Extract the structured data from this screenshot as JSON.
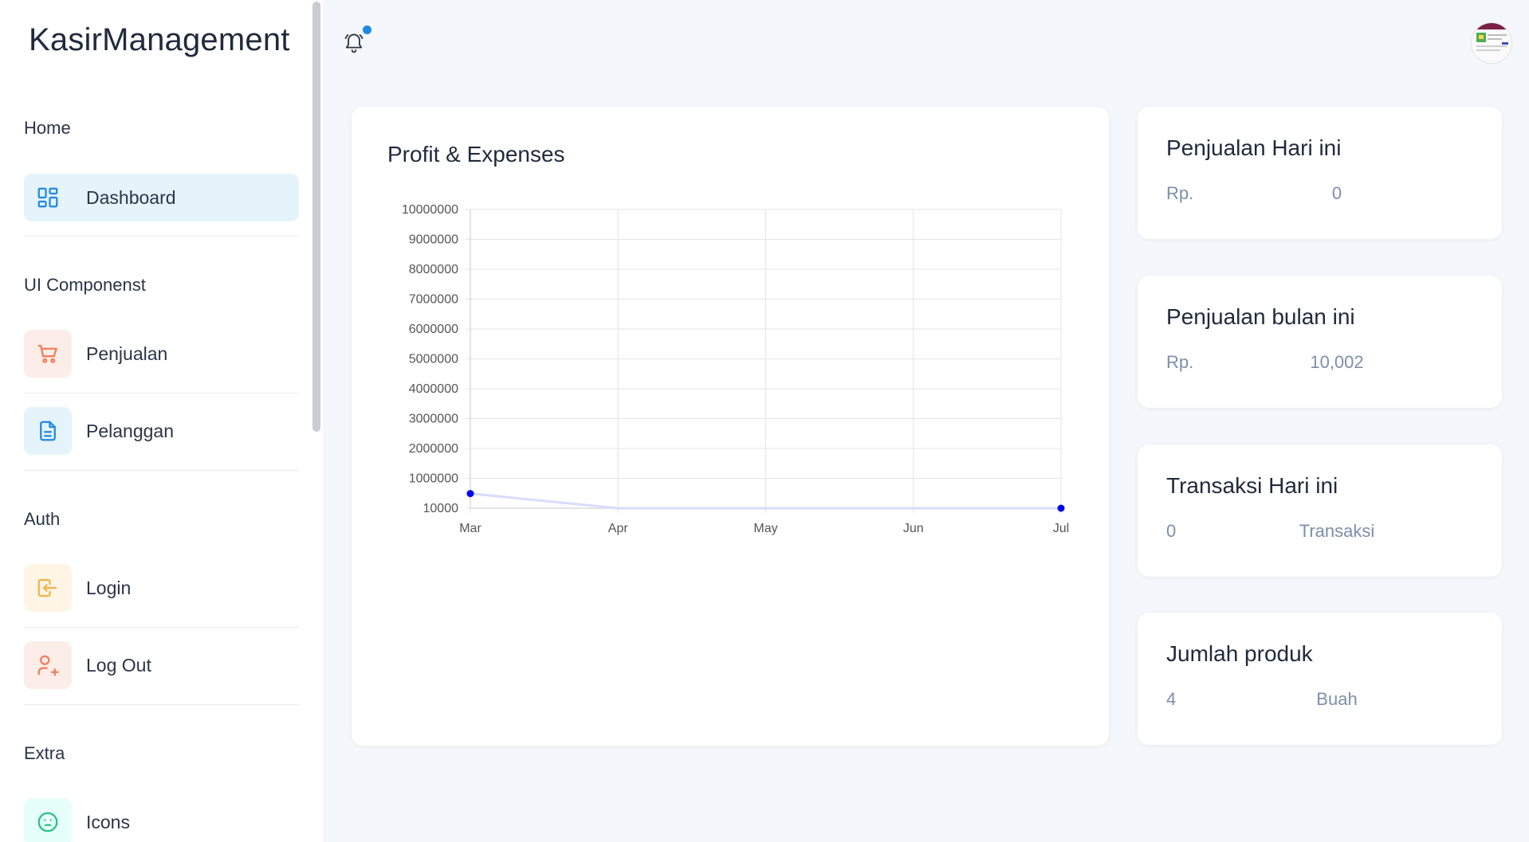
{
  "app": {
    "brand": "KasirManagement"
  },
  "sidebar": {
    "sections": [
      {
        "title": "Home",
        "items": [
          {
            "label": "Dashboard",
            "icon": "dashboard-icon",
            "active": true,
            "color": "#1e88e5"
          }
        ]
      },
      {
        "title": "UI Componenst",
        "items": [
          {
            "label": "Penjualan",
            "icon": "cart-icon",
            "color": "#f27c5a",
            "bg": "#fdede8"
          },
          {
            "label": "Pelanggan",
            "icon": "document-icon",
            "color": "#1e88e5",
            "bg": "#e5f3fb"
          }
        ]
      },
      {
        "title": "Auth",
        "items": [
          {
            "label": "Login",
            "icon": "login-icon",
            "color": "#f5b14c",
            "bg": "#fef5e5"
          },
          {
            "label": "Log Out",
            "icon": "user-plus-icon",
            "color": "#f27c5a",
            "bg": "#fdede8"
          }
        ]
      },
      {
        "title": "Extra",
        "items": [
          {
            "label": "Icons",
            "icon": "mood-icon",
            "color": "#27c281",
            "bg": "#e6fffa"
          }
        ]
      }
    ]
  },
  "header": {
    "notification_icon": "bell-icon",
    "has_unread": true
  },
  "chart": {
    "title": "Profit & Expenses",
    "chart_data": {
      "type": "line",
      "x": [
        "Mar",
        "Apr",
        "May",
        "Jun",
        "Jul"
      ],
      "y_ticks": [
        "10000",
        "1000000",
        "2000000",
        "3000000",
        "4000000",
        "5000000",
        "6000000",
        "7000000",
        "8000000",
        "9000000",
        "10000000"
      ],
      "ylim": [
        10000,
        10000000
      ],
      "series": [
        {
          "values": [
            500000,
            10000,
            10000,
            10000,
            10000
          ],
          "color": "#0000ee"
        }
      ],
      "grid": true
    }
  },
  "stats": [
    {
      "title": "Penjualan Hari ini",
      "left": "Rp.",
      "right": "0"
    },
    {
      "title": "Penjualan bulan ini",
      "left": "Rp.",
      "right": "10,002"
    },
    {
      "title": "Transaksi Hari ini",
      "left": "0",
      "right": "Transaksi"
    },
    {
      "title": "Jumlah produk",
      "left": "4",
      "right": "Buah"
    }
  ]
}
